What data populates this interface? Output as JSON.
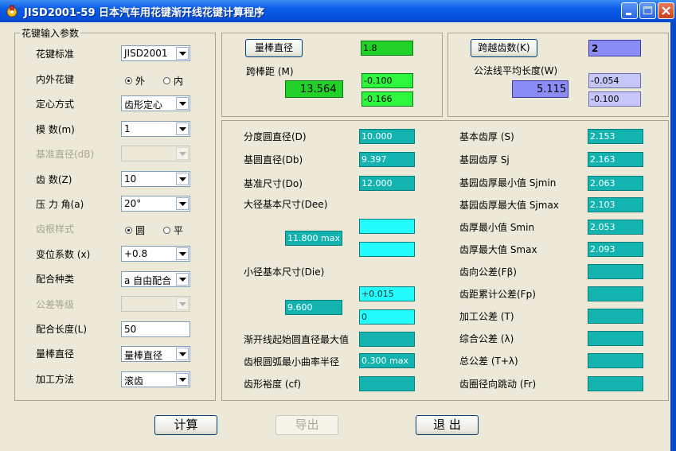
{
  "window": {
    "title": "JISD2001-59 日本汽车用花键渐开线花键计算程序"
  },
  "input_group": {
    "legend": "花键输入参数",
    "spline_standard": {
      "label": "花键标准",
      "value": "JISD2001"
    },
    "inner_outer": {
      "label": "内外花键",
      "options": [
        "外",
        "内"
      ],
      "selected": "外"
    },
    "centering": {
      "label": "定心方式",
      "value": "齿形定心"
    },
    "module": {
      "label": "模    数(m)",
      "value": "1"
    },
    "base_diameter": {
      "label": "基准直径(dB)",
      "value": ""
    },
    "teeth": {
      "label": "齿    数(Z)",
      "value": "10"
    },
    "pressure_angle": {
      "label": "压 力 角(a)",
      "value": "20°"
    },
    "root_style": {
      "label": "齿根样式",
      "options": [
        "圆",
        "平"
      ],
      "selected": "圆"
    },
    "shift_coef": {
      "label": "变位系数 (x)",
      "value": "+0.8"
    },
    "fit_type": {
      "label": "配合种类",
      "value": "a 自由配合"
    },
    "tolerance_grade": {
      "label": "公差等级",
      "value": ""
    },
    "fit_length": {
      "label": "配合长度(L)",
      "value": "50"
    },
    "pin_diameter": {
      "label": "量棒直径",
      "value": "量棒直径"
    },
    "process": {
      "label": "加工方法",
      "value": "滚齿"
    }
  },
  "pin_panel": {
    "button": "量棒直径",
    "pin_value": "1.8",
    "over_pin_label": "跨棒距 (M)",
    "over_pin_value": "13.564",
    "tol_upper": "-0.100",
    "tol_lower": "-0.166"
  },
  "span_panel": {
    "button": "跨越齿数(K)",
    "span_teeth": "2",
    "mean_length_label": "公法线平均长度(W)",
    "mean_length_value": "5.115",
    "tol_upper": "-0.054",
    "tol_lower": "-0.100"
  },
  "results_left": {
    "pitch_dia": {
      "label": "分度圆直径(D)",
      "value": "10.000"
    },
    "base_circle_dia": {
      "label": "基圆直径(Db)",
      "value": "9.397"
    },
    "basic_size": {
      "label": "基准尺寸(Do)",
      "value": "12.000"
    },
    "major_dia_label": "大径基本尺寸(Dee)",
    "major_dia_value": "11.800 max",
    "major_tol_1": "",
    "major_tol_2": "",
    "minor_dia_label": "小径基本尺寸(Die)",
    "minor_dia_value": "9.600",
    "minor_tol_upper": "+0.015",
    "minor_tol_lower": "0",
    "involute_start": {
      "label": "渐开线起始圆直径最大值",
      "value": ""
    },
    "root_fillet": {
      "label": "齿根圆弧最小曲率半径",
      "value": "0.300 max"
    },
    "form_clearance": {
      "label": "齿形裕度 (cf)",
      "value": ""
    }
  },
  "results_right": {
    "basic_thickness": {
      "label": "基本齿厚 (S)",
      "value": "2.153"
    },
    "base_thickness": {
      "label": "基园齿厚 Sj",
      "value": "2.163"
    },
    "base_thickness_min": {
      "label": "基园齿厚最小值 Sjmin",
      "value": "2.063"
    },
    "base_thickness_max": {
      "label": "基园齿厚最大值 Sjmax",
      "value": "2.103"
    },
    "thickness_min": {
      "label": "齿厚最小值 Smin",
      "value": "2.053"
    },
    "thickness_max": {
      "label": "齿厚最大值 Smax",
      "value": "2.093"
    },
    "lead_tol": {
      "label": "齿向公差(Fβ)",
      "value": ""
    },
    "pitch_cum_tol": {
      "label": "齿距累计公差(Fp)",
      "value": ""
    },
    "machining_tol": {
      "label": "加工公差 (T)",
      "value": ""
    },
    "composite_tol": {
      "label": "综合公差 (λ)",
      "value": ""
    },
    "total_tol": {
      "label": "总公差 (T+λ)",
      "value": ""
    },
    "runout": {
      "label": "齿圈径向跳动 (Fr)",
      "value": ""
    }
  },
  "buttons": {
    "calculate": "计算",
    "export": "导出",
    "exit": "退 出"
  },
  "colors": {
    "teal": "#13b3b0",
    "cyan": "#22fcfc",
    "green": "#22d128",
    "blue": "#8c8cf6",
    "lavender": "#c6c6f8"
  }
}
